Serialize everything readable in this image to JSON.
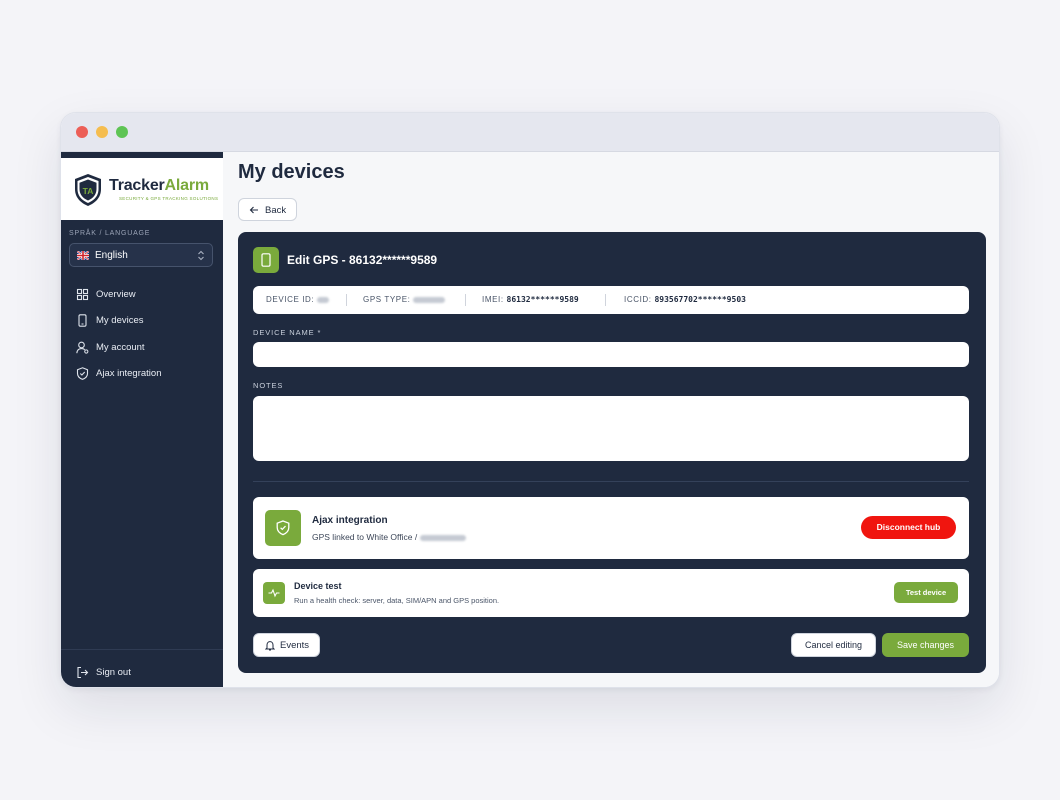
{
  "app": {
    "brand_name_part1": "Tracker",
    "brand_name_part2": "Alarm",
    "brand_tagline": "SECURITY & GPS TRACKING SOLUTIONS",
    "brand_colors": {
      "navy": "#1f2a3f",
      "green": "#7aaa3c",
      "danger": "#f0150f"
    }
  },
  "sidebar": {
    "language_label": "SPRÅK / LANGUAGE",
    "language_value": "English",
    "language_flag": "uk-flag-icon",
    "items": [
      {
        "label": "Overview",
        "icon": "grid-icon"
      },
      {
        "label": "My devices",
        "icon": "phone-icon"
      },
      {
        "label": "My account",
        "icon": "user-icon"
      },
      {
        "label": "Ajax integration",
        "icon": "shield-icon"
      }
    ],
    "signout_label": "Sign out"
  },
  "main": {
    "title": "My devices",
    "back_label": "Back"
  },
  "edit_card": {
    "title": "Edit GPS - 86132******9589",
    "info": {
      "device_id_label": "DEVICE ID:",
      "gps_type_label": "GPS TYPE:",
      "imei_label": "IMEI:",
      "imei_value": "86132******9589",
      "iccid_label": "ICCID:",
      "iccid_value": "893567702******9503"
    },
    "device_name_label": "DEVICE NAME *",
    "device_name_value": "",
    "notes_label": "NOTES",
    "notes_value": ""
  },
  "ajax_panel": {
    "title": "Ajax integration",
    "subtitle": "GPS linked to White Office / ",
    "disconnect_label": "Disconnect hub"
  },
  "test_panel": {
    "title": "Device test",
    "subtitle": "Run a health check: server, data, SIM/APN and GPS position.",
    "button_label": "Test device"
  },
  "footer": {
    "events_label": "Events",
    "cancel_label": "Cancel editing",
    "save_label": "Save changes"
  }
}
